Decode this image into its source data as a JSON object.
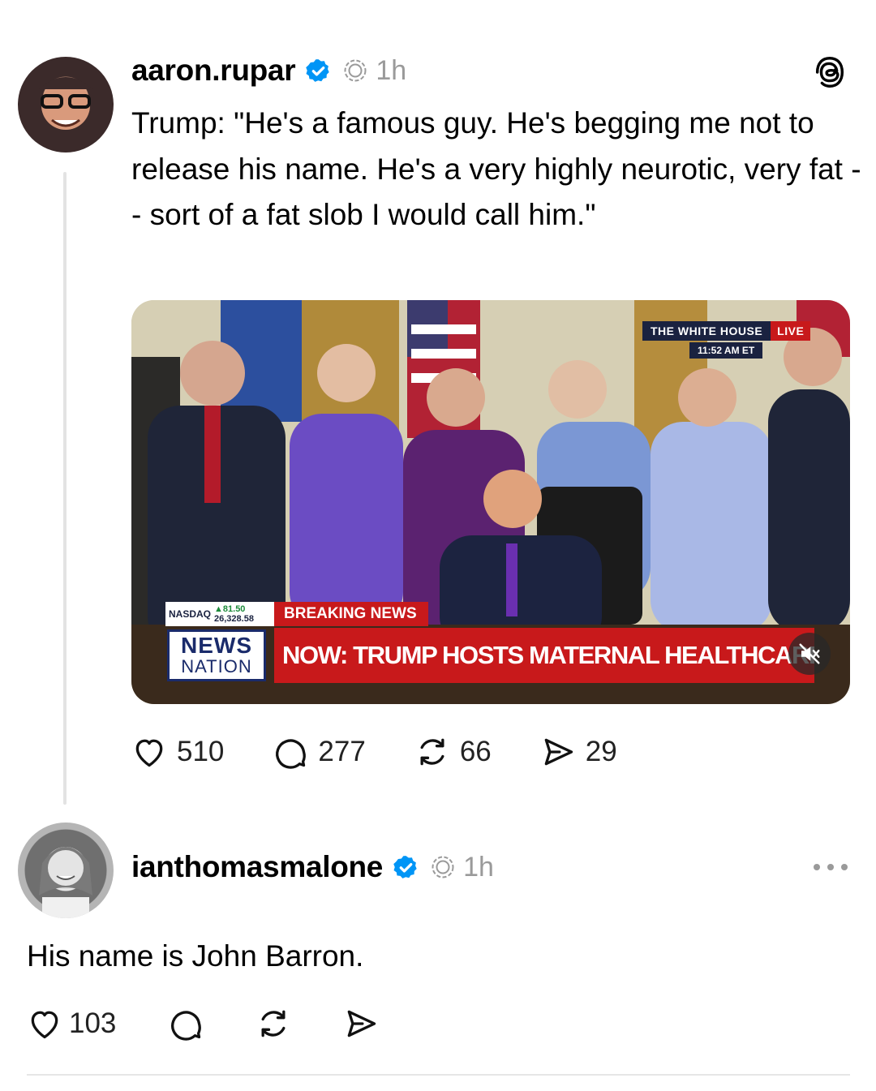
{
  "post": {
    "username": "aaron.rupar",
    "timestamp": "1h",
    "text": "Trump: \"He's a famous guy. He's begging me not to release his name. He's a very highly neurotic, very fat -- sort of a fat slob I would call him.\"",
    "media": {
      "channel_badge": "THE WHITE HOUSE",
      "live_label": "LIVE",
      "time": "11:52 AM ET",
      "ticker_label": "NASDAQ",
      "ticker_change": "▲81.50",
      "ticker_value": "26,328.58",
      "breaking_label": "BREAKING NEWS",
      "network_line1": "NEWS",
      "network_line2": "NATION",
      "headline": "NOW: TRUMP HOSTS MATERNAL HEALTHCARE EVE"
    },
    "actions": {
      "likes": "510",
      "replies": "277",
      "reposts": "66",
      "shares": "29"
    }
  },
  "reply": {
    "username": "ianthomasmalone",
    "timestamp": "1h",
    "text": "His name is John Barron.",
    "actions": {
      "likes": "103"
    }
  },
  "colors": {
    "verified": "#0095f6",
    "muted_text": "#9a9a9a",
    "breaking_red": "#c8191b",
    "network_navy": "#1a2b6b"
  },
  "icons": [
    "threads-logo-icon",
    "verified-badge-icon",
    "threads-glyph-icon",
    "more-icon",
    "heart-icon",
    "comment-icon",
    "repost-icon",
    "share-icon",
    "mute-icon"
  ]
}
